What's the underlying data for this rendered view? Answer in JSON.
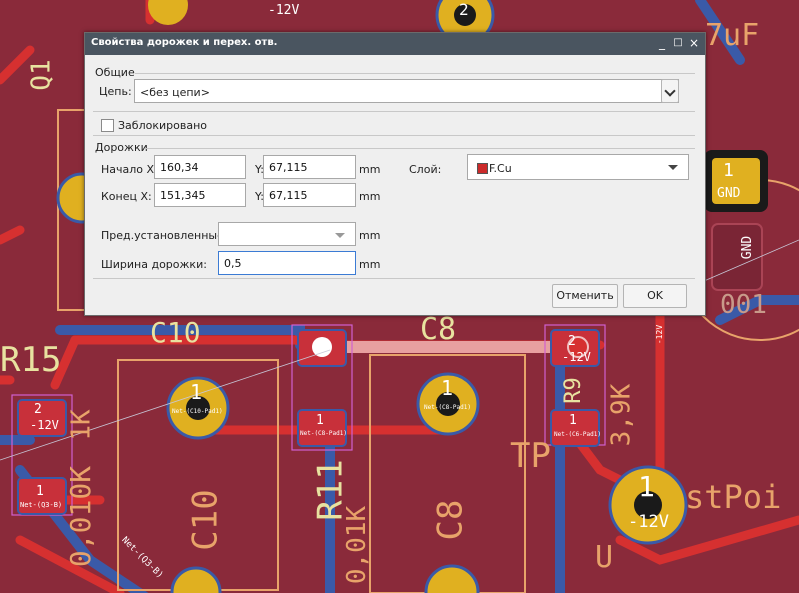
{
  "board": {
    "pad_numbers": [
      "2",
      "1",
      "1",
      "1",
      "1",
      "1",
      "1",
      "1",
      "2",
      "1",
      "1",
      "1",
      "2"
    ],
    "net_labels": [
      "-12V",
      "GND",
      "GND",
      "Net-(C8-Pad1)",
      "Net-(C10-Pad1)",
      "Net-(C6-Pad1)",
      "Net-(Q3-B)",
      "-12V",
      "-12V",
      "-12V",
      "-12V",
      "Net-(Q3-B)",
      "Net-(C8-Pad1)"
    ],
    "silk_texts": [
      "R15",
      "C10",
      "C8",
      "R11",
      "C10",
      "C8",
      "R9",
      "TP",
      "Q1",
      "7uF",
      "stPoi",
      "0,010K",
      "0,01K",
      "3,9K",
      "1K",
      "001",
      "U"
    ]
  },
  "dialog": {
    "title": "Свойства дорожек и перех. отв.",
    "general_group": "Общие",
    "net_label": "Цепь:",
    "net_value": "<без цепи>",
    "locked_label": "Заблокировано",
    "tracks_group": "Дорожки",
    "start_x_label": "Начало X:",
    "start_x_value": "160,34",
    "start_y_label": "Y:",
    "start_y_value": "67,115",
    "start_unit": "mm",
    "end_x_label": "Конец X:",
    "end_x_value": "151,345",
    "end_y_label": "Y:",
    "end_y_value": "67,115",
    "end_unit": "mm",
    "layer_label": "Слой:",
    "layer_value": "F.Cu",
    "layer_color": "#cc2b2b",
    "predefined_label": "Пред.установленные:",
    "predefined_unit": "mm",
    "width_label": "Ширина дорожки:",
    "width_value": "0,5",
    "width_unit": "mm",
    "cancel_label": "Отменить",
    "ok_label": "OK",
    "minimize": "_",
    "maximize": "□",
    "close": "×"
  }
}
